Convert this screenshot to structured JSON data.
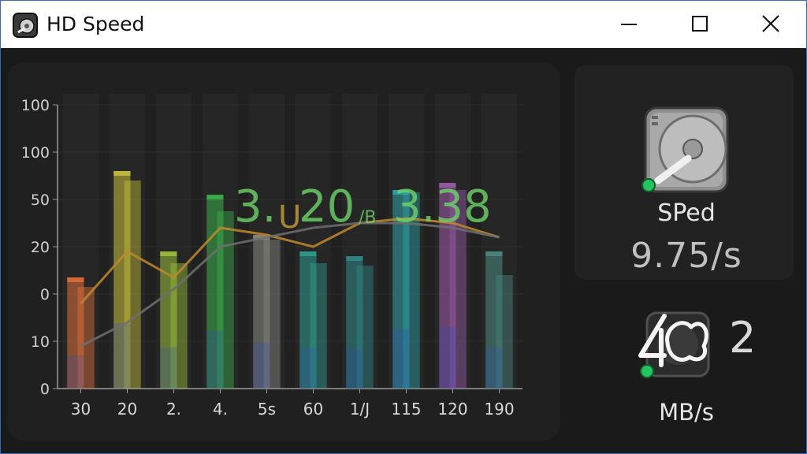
{
  "window": {
    "title": "HD Speed",
    "app_icon": "hard-disk-icon",
    "controls": [
      "minimize-icon",
      "maximize-icon",
      "close-icon"
    ]
  },
  "chart_data": {
    "type": "bar",
    "y_tick_labels": [
      "100",
      "100",
      "50",
      "20",
      "0",
      "10",
      "0"
    ],
    "categories": [
      "30",
      "20",
      "2.",
      "4.",
      "5s",
      "60",
      "1/J",
      "115",
      "120",
      "190"
    ],
    "series": [
      {
        "values": [
          47,
          92,
          58,
          82,
          65,
          58,
          56,
          84,
          87,
          58
        ]
      },
      {
        "values": [
          43,
          88,
          53,
          75,
          63,
          53,
          52,
          83,
          84,
          48
        ]
      }
    ],
    "overlay_lines": [
      {
        "color": "#c08a2a",
        "values": [
          36,
          58,
          47,
          68,
          65,
          60,
          70,
          72,
          70,
          64
        ]
      },
      {
        "color": "#6e6e6e",
        "values": [
          18,
          28,
          42,
          60,
          64,
          68,
          70,
          70,
          68,
          64
        ]
      }
    ],
    "overlay_readings": [
      "3.",
      "U",
      "20",
      "/B",
      "3.38"
    ],
    "ylim": [
      0,
      120
    ],
    "grid": true,
    "colors": [
      "#e0703a",
      "#c8c13a",
      "#9cc03a",
      "#3bb04a",
      "#8a8a80",
      "#2e9e8e",
      "#2e8a86",
      "#2fa3a8",
      "#9a5aa8",
      "#4a8a80"
    ]
  },
  "side": {
    "drive_icon": "hard-disk-icon",
    "speed_label": "SPed",
    "speed_value": "9.75/s",
    "activity_icon": "disk-activity-icon",
    "disk_value": "2",
    "unit_label": "MB/s",
    "status_color": "#22c55e"
  }
}
